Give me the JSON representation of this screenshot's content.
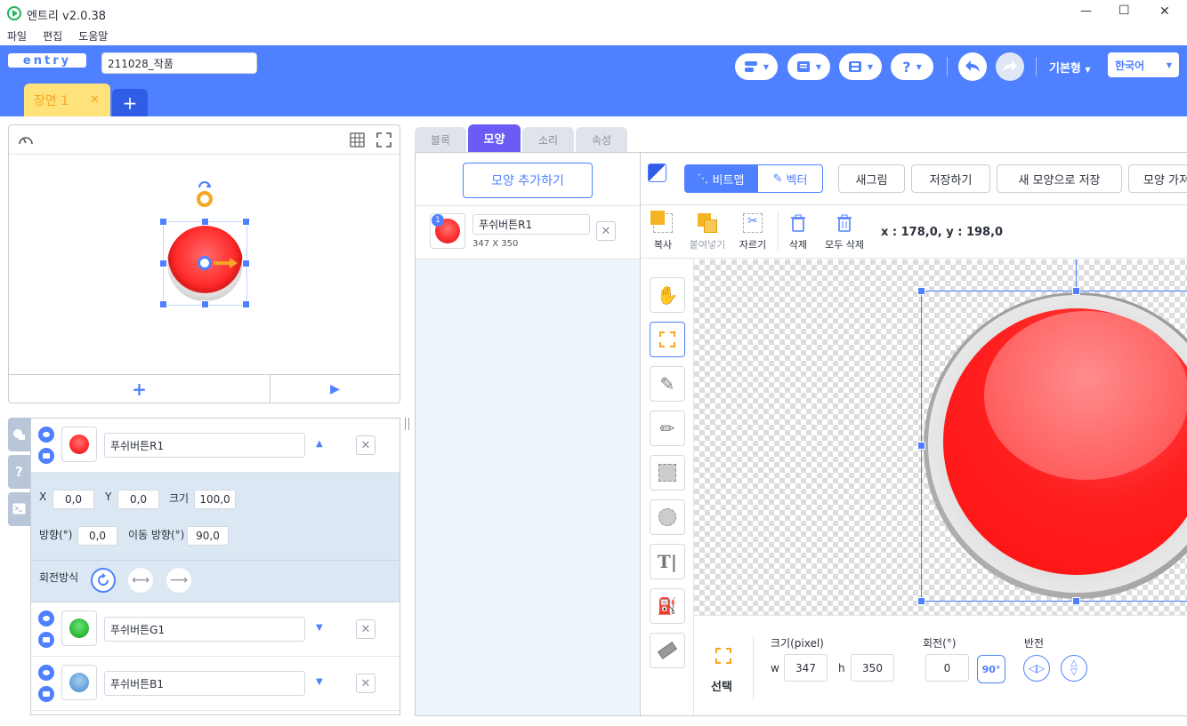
{
  "window": {
    "title": "엔트리 v2.0.38",
    "minimize": "—",
    "maximize": "☐",
    "close": "✕"
  },
  "menu": [
    "파일",
    "편집",
    "도움말"
  ],
  "header": {
    "logo": "entry",
    "project_name": "211028_작품",
    "mode": "기본형",
    "language": "한국어"
  },
  "scene": {
    "tab_label": "장면 1",
    "add": "+"
  },
  "stage": {
    "add_label": "+",
    "play_label": "▶"
  },
  "objects": [
    {
      "name": "푸쉬버튼R1",
      "color": "#ff3b3b",
      "arrow": "▲"
    },
    {
      "name": "푸쉬버튼G1",
      "color": "#2fbf3a",
      "arrow": "▼"
    },
    {
      "name": "푸쉬버튼B1",
      "color": "#6aa6dc",
      "arrow": "▼"
    }
  ],
  "props": {
    "x_label": "X",
    "x": "0,0",
    "y_label": "Y",
    "y": "0,0",
    "size_label": "크기",
    "size": "100,0",
    "dir_label": "방향(°)",
    "dir": "0,0",
    "move_label": "이동 방향(°)",
    "move": "90,0",
    "rotation_label": "회전방식"
  },
  "tabs": [
    "블록",
    "모양",
    "소리",
    "속성"
  ],
  "shape": {
    "add_button": "모양 추가하기",
    "item_name": "푸쉬버튼R1",
    "item_size": "347 X 350",
    "item_number": "1"
  },
  "paint": {
    "bitmap": "비트맵",
    "vector": "벡터",
    "new": "새그림",
    "save": "저장하기",
    "save_new": "새 모양으로 저장",
    "import": "모양 가져오기",
    "copy": "복사",
    "paste": "붙여넣기",
    "cut": "자르기",
    "delete": "삭제",
    "delete_all": "모두 삭제",
    "coords": "x : 178,0, y : 198,0",
    "select_label": "선택",
    "size_label": "크기(pixel)",
    "w_label": "w",
    "w": "347",
    "h_label": "h",
    "h": "350",
    "rotate_label": "회전(°)",
    "rotate": "0",
    "rotate90": "90°",
    "flip_label": "반전"
  },
  "colors": {
    "accent": "#4f80ff",
    "scene_tab": "#ffe27a",
    "selected_tab": "#6b5cf5"
  }
}
